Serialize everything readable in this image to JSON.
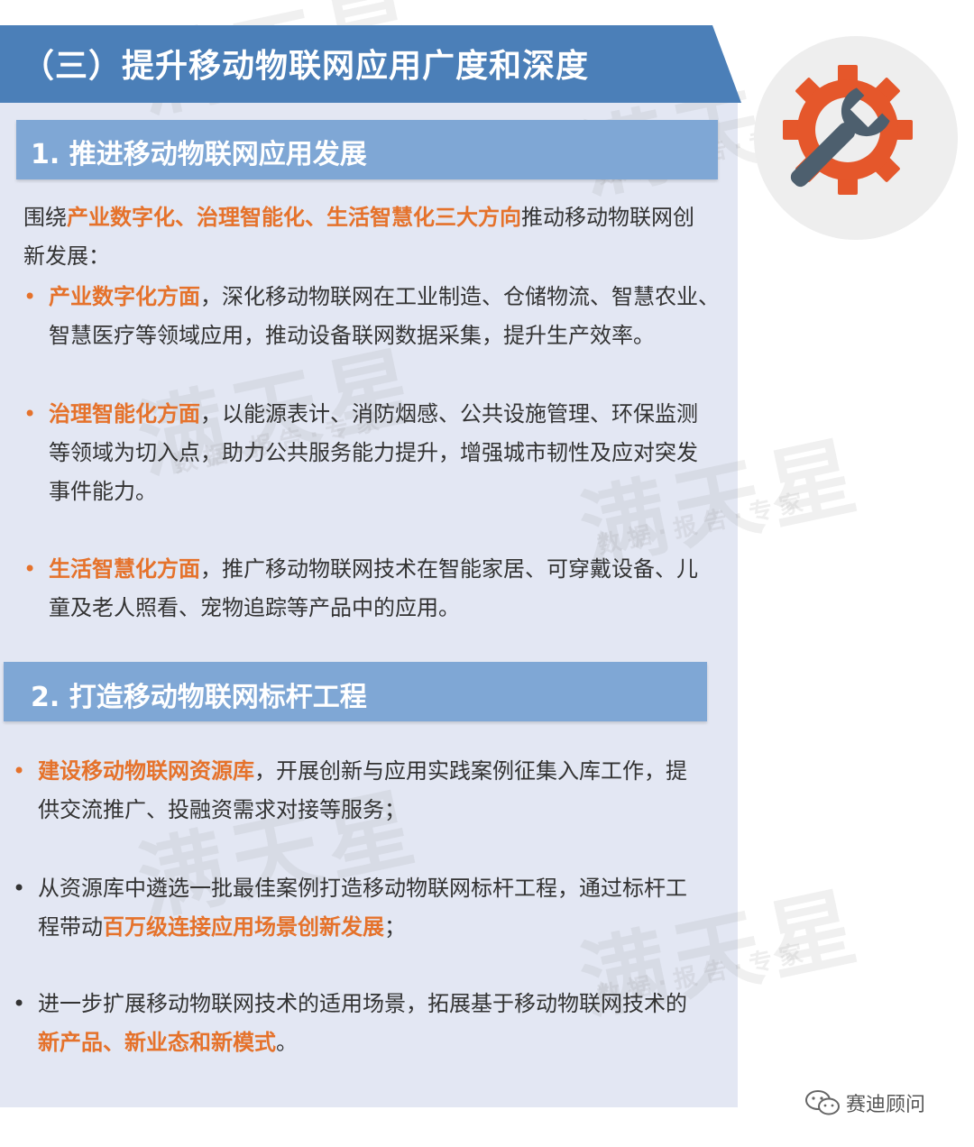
{
  "title": "（三）提升移动物联网应用广度和深度",
  "watermark": {
    "main": "满天星",
    "sub": "数据·报告·专家"
  },
  "section1": {
    "heading": "1. 推进移动物联网应用发展",
    "intro": {
      "pre": "围绕",
      "highlight": "产业数字化、治理智能化、生活智慧化三大方向",
      "post1": "推动移动物联网创",
      "post2": "新发展："
    },
    "items": [
      {
        "bullet": "•",
        "highlight": "产业数字化方面",
        "line1": "，深化移动物联网在工业制造、仓储物流、智慧农业、",
        "line2": "智慧医疗等领域应用，推动设备联网数据采集，提升生产效率。"
      },
      {
        "bullet": "•",
        "highlight": "治理智能化方面",
        "line1": "，以能源表计、消防烟感、公共设施管理、环保监测",
        "line2": "等领域为切入点，助力公共服务能力提升，增强城市韧性及应对突发",
        "line3": "事件能力。"
      },
      {
        "bullet": "•",
        "highlight": "生活智慧化方面",
        "line1": "，推广移动物联网技术在智能家居、可穿戴设备、儿",
        "line2": "童及老人照看、宠物追踪等产品中的应用。"
      }
    ]
  },
  "section2": {
    "heading": "2. 打造移动物联网标杆工程",
    "items": [
      {
        "bullet": "•",
        "highlight": "建设移动物联网资源库",
        "line1": "，开展创新与应用实践案例征集入库工作，提",
        "line2": "供交流推广、投融资需求对接等服务；"
      },
      {
        "bullet": "•",
        "line1": "从资源库中遴选一批最佳案例打造移动物联网标杆工程，通过标杆工",
        "line2_pre": "程带动",
        "line2_highlight": "百万级连接应用场景创新发展",
        "line2_post": "；"
      },
      {
        "bullet": "•",
        "line1": "进一步扩展移动物联网技术的适用场景，拓展基于移动物联网技术的",
        "line2_highlight": "新产品、新业态和新模式",
        "line2_post": "。"
      }
    ]
  },
  "footer": {
    "label": "赛迪顾问",
    "icon": "wechat-icon"
  },
  "colors": {
    "accent": "#e5722b",
    "title_bar": "#4b7fb8",
    "section_bar": "#7fa7d5",
    "panel": "#e3e7f3",
    "gear": "#e5572b",
    "wrench": "#4d5f6e"
  }
}
